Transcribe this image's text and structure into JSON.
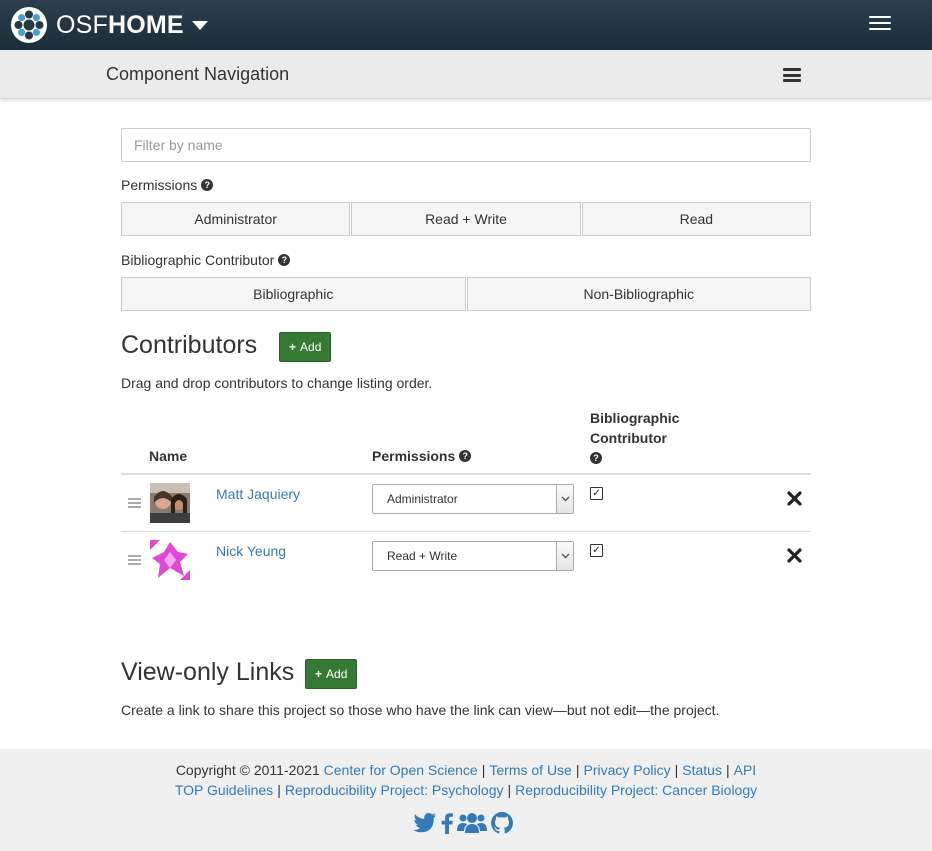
{
  "navbar": {
    "brand_osf": "OSF",
    "brand_home": "HOME"
  },
  "component_nav": {
    "title": "Component Navigation"
  },
  "filter": {
    "placeholder": "Filter by name"
  },
  "permissions_filter": {
    "label": "Permissions",
    "options": [
      "Administrator",
      "Read + Write",
      "Read"
    ]
  },
  "bibliographic_filter": {
    "label": "Bibliographic Contributor",
    "options": [
      "Bibliographic",
      "Non-Bibliographic"
    ]
  },
  "contributors": {
    "title": "Contributors",
    "add_label": "Add",
    "help": "Drag and drop contributors to change listing order.",
    "headers": {
      "name": "Name",
      "permissions": "Permissions",
      "bibliographic_line1": "Bibliographic",
      "bibliographic_line2": "Contributor"
    },
    "rows": [
      {
        "name": "Matt Jaquiery",
        "permission": "Administrator",
        "bibliographic": true
      },
      {
        "name": "Nick Yeung",
        "permission": "Read + Write",
        "bibliographic": true
      }
    ]
  },
  "view_only_links": {
    "title": "View-only Links",
    "add_label": "Add",
    "help": "Create a link to share this project so those who have the link can view—but not edit—the project."
  },
  "footer": {
    "copyright": "Copyright © 2011-2021",
    "links_line1": [
      "Center for Open Science",
      "Terms of Use",
      "Privacy Policy",
      "Status",
      "API"
    ],
    "links_line2": [
      "TOP Guidelines",
      "Reproducibility Project: Psychology",
      "Reproducibility Project: Cancer Biology"
    ],
    "social_icons": [
      "twitter-icon",
      "facebook-icon",
      "group-icon",
      "github-icon"
    ]
  },
  "colors": {
    "navbar_bg": "#263947",
    "add_button": "#357935",
    "link": "#337ab7"
  }
}
